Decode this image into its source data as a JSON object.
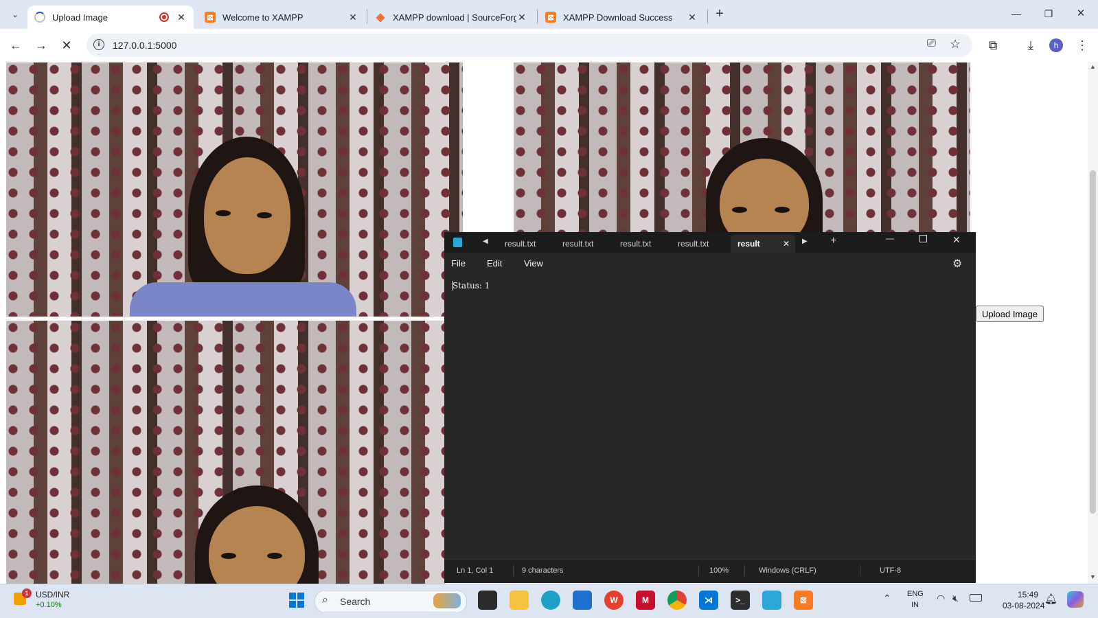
{
  "browser": {
    "tabs": [
      {
        "title": "Upload Image",
        "favicon": "loading-spinner-icon",
        "active": true
      },
      {
        "title": "Welcome to XAMPP",
        "favicon": "xampp-icon"
      },
      {
        "title": "XAMPP download | SourceForg",
        "favicon": "sourceforge-icon"
      },
      {
        "title": "XAMPP Download Success",
        "favicon": "xampp-icon"
      }
    ],
    "new_tab": "+",
    "url": "127.0.0.1:5000",
    "profile_initial": "h",
    "window_controls": {
      "minimize": "—",
      "restore": "❐",
      "close": "✕"
    }
  },
  "page": {
    "upload_button_label": "Upload Image"
  },
  "notepad": {
    "tabs": [
      "result.txt",
      "result.txt",
      "result.txt",
      "result.txt"
    ],
    "active_tab": "result",
    "menu": [
      "File",
      "Edit",
      "View"
    ],
    "content": "Status: 1",
    "status": {
      "position": "Ln 1, Col 1",
      "characters": "9 characters",
      "zoom": "100%",
      "line_ending": "Windows (CRLF)",
      "encoding": "UTF-8"
    }
  },
  "taskbar": {
    "widget_title": "USD/INR",
    "widget_change": "+0.10%",
    "widget_badge": "1",
    "search_placeholder": "Search",
    "lang_line1": "ENG",
    "lang_line2": "IN",
    "time": "15:49",
    "date": "03-08-2024"
  },
  "colors": {
    "accent": "#0b57d0",
    "notepad_bg": "#272727",
    "taskbar_bg": "#dde5f2",
    "tabstrip_bg": "#dfe7f5"
  }
}
